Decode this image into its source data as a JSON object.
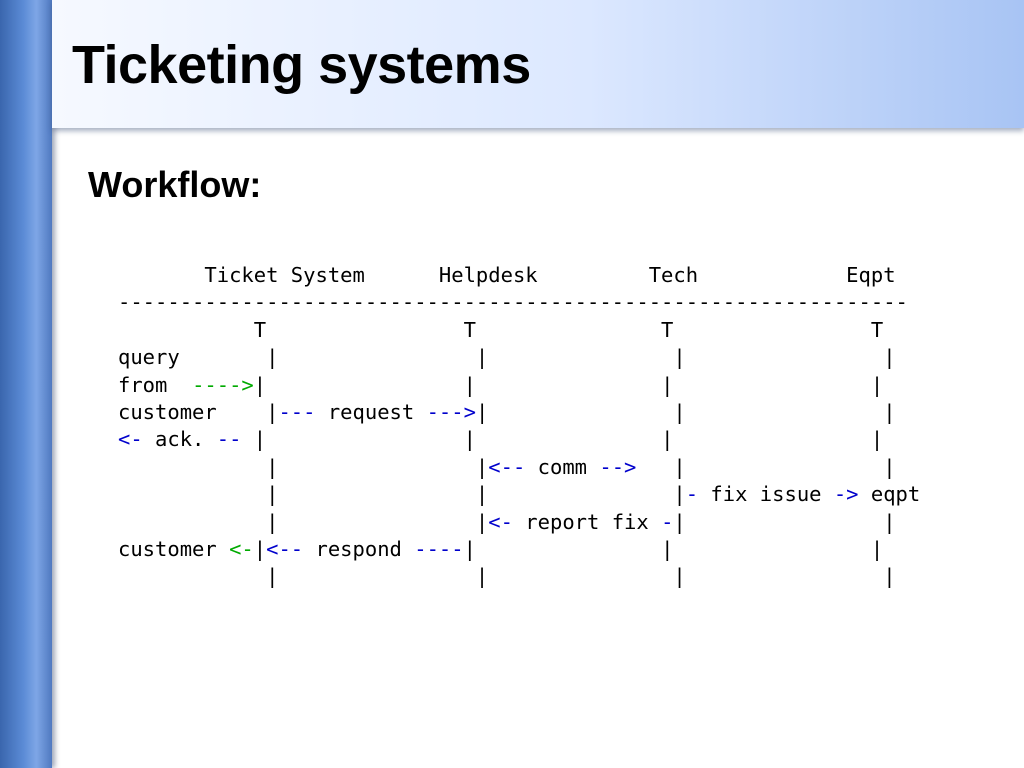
{
  "slide": {
    "title": "Ticketing systems",
    "subtitle": "Workflow:"
  },
  "diagram": {
    "colors": {
      "text": "#000000",
      "arrow_blue": "#0000cc",
      "arrow_green": "#00aa00"
    },
    "lines": [
      [
        {
          "t": "       Ticket System      Helpdesk         Tech            Eqpt",
          "c": "k"
        }
      ],
      [
        {
          "t": "----------------------------------------------------------------",
          "c": "k"
        }
      ],
      [
        {
          "t": "           T                T               T                T",
          "c": "k"
        }
      ],
      [
        {
          "t": "query       |                |               |                |",
          "c": "k"
        }
      ],
      [
        {
          "t": "from  ",
          "c": "k"
        },
        {
          "t": "---->",
          "c": "g"
        },
        {
          "t": "|                |               |                |",
          "c": "k"
        }
      ],
      [
        {
          "t": "customer    |",
          "c": "k"
        },
        {
          "t": "---",
          "c": "b"
        },
        {
          "t": " request ",
          "c": "k"
        },
        {
          "t": "--->",
          "c": "b"
        },
        {
          "t": "|               |                |",
          "c": "k"
        }
      ],
      [
        {
          "t": "<-",
          "c": "b"
        },
        {
          "t": " ack. ",
          "c": "k"
        },
        {
          "t": "--",
          "c": "b"
        },
        {
          "t": " |                |               |                |",
          "c": "k"
        }
      ],
      [
        {
          "t": "            |                |",
          "c": "k"
        },
        {
          "t": "<--",
          "c": "b"
        },
        {
          "t": " comm ",
          "c": "k"
        },
        {
          "t": "-->",
          "c": "b"
        },
        {
          "t": "   |                |",
          "c": "k"
        }
      ],
      [
        {
          "t": "            |                |               |",
          "c": "k"
        },
        {
          "t": "-",
          "c": "b"
        },
        {
          "t": " fix issue ",
          "c": "k"
        },
        {
          "t": "->",
          "c": "b"
        },
        {
          "t": " eqpt",
          "c": "k"
        }
      ],
      [
        {
          "t": "            |                |",
          "c": "k"
        },
        {
          "t": "<-",
          "c": "b"
        },
        {
          "t": " report fix ",
          "c": "k"
        },
        {
          "t": "-",
          "c": "b"
        },
        {
          "t": "|                |",
          "c": "k"
        }
      ],
      [
        {
          "t": "customer ",
          "c": "k"
        },
        {
          "t": "<-",
          "c": "g"
        },
        {
          "t": "|",
          "c": "k"
        },
        {
          "t": "<--",
          "c": "b"
        },
        {
          "t": " respond ",
          "c": "k"
        },
        {
          "t": "----",
          "c": "b"
        },
        {
          "t": "|               |                |",
          "c": "k"
        }
      ],
      [
        {
          "t": "            |                |               |                |",
          "c": "k"
        }
      ]
    ]
  }
}
